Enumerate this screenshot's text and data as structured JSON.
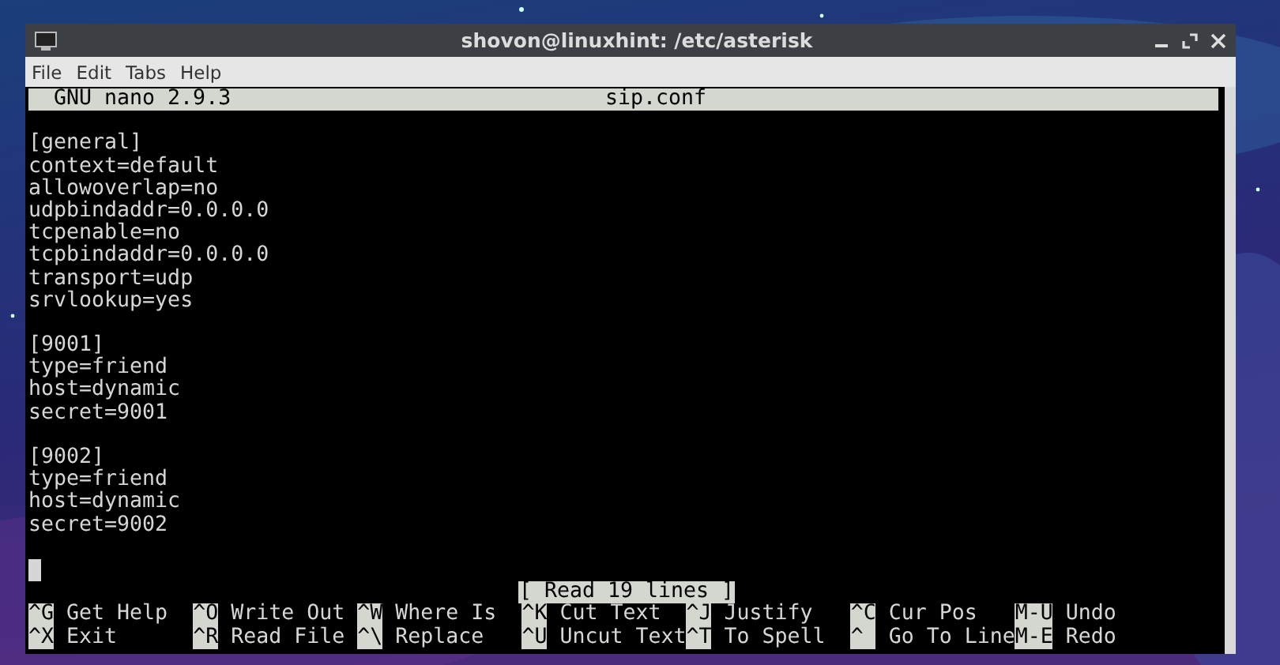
{
  "window": {
    "title": "shovon@linuxhint: /etc/asterisk"
  },
  "menu": [
    "File",
    "Edit",
    "Tabs",
    "Help"
  ],
  "editor": {
    "app": "GNU nano 2.9.3",
    "filename": "sip.conf",
    "sections": [
      [
        "[general]",
        "context=default",
        "allowoverlap=no",
        "udpbindaddr=0.0.0.0",
        "tcpenable=no",
        "tcpbindaddr=0.0.0.0",
        "transport=udp",
        "srvlookup=yes"
      ],
      [
        "[9001]",
        "type=friend",
        "host=dynamic",
        "secret=9001"
      ],
      [
        "[9002]",
        "type=friend",
        "host=dynamic",
        "secret=9002"
      ]
    ],
    "status": "[ Read 19 lines ]"
  },
  "shortcuts": [
    [
      {
        "key": "^G",
        "label": "Get Help"
      },
      {
        "key": "^O",
        "label": "Write Out"
      },
      {
        "key": "^W",
        "label": "Where Is"
      },
      {
        "key": "^K",
        "label": "Cut Text"
      },
      {
        "key": "^J",
        "label": "Justify"
      },
      {
        "key": "^C",
        "label": "Cur Pos"
      },
      {
        "key": "M-U",
        "label": "Undo"
      }
    ],
    [
      {
        "key": "^X",
        "label": "Exit"
      },
      {
        "key": "^R",
        "label": "Read File"
      },
      {
        "key": "^\\",
        "label": "Replace"
      },
      {
        "key": "^U",
        "label": "Uncut Text"
      },
      {
        "key": "^T",
        "label": "To Spell"
      },
      {
        "key": "^",
        "label": "Go To Line"
      },
      {
        "key": "M-E",
        "label": "Redo"
      }
    ]
  ]
}
